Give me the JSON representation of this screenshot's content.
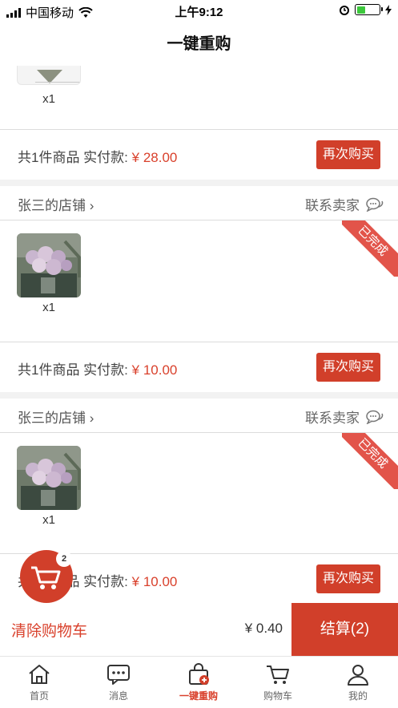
{
  "status_bar": {
    "carrier": "中国移动",
    "time": "上午9:12"
  },
  "nav": {
    "title": "一键重购"
  },
  "orders": [
    {
      "quantity": "x1",
      "summary_label": "共1件商品 实付款:",
      "price": "¥ 28.00",
      "rebuy_label": "再次购买"
    },
    {
      "shop_name": "张三的店铺",
      "contact_label": "联系卖家",
      "status_ribbon": "已完成",
      "quantity": "x1",
      "summary_label": "共1件商品 实付款:",
      "price": "¥ 10.00",
      "rebuy_label": "再次购买"
    },
    {
      "shop_name": "张三的店铺",
      "contact_label": "联系卖家",
      "status_ribbon": "已完成",
      "quantity": "x1",
      "summary_label": "共1件商品 实付款:",
      "price": "¥ 10.00",
      "rebuy_label": "再次购买"
    }
  ],
  "cart_fab": {
    "badge_count": "2"
  },
  "checkout": {
    "clear_label": "清除购物车",
    "total": "¥ 0.40",
    "settle_label": "结算(2)"
  },
  "tabbar": {
    "items": [
      {
        "label": "首页",
        "icon": "home-icon"
      },
      {
        "label": "消息",
        "icon": "message-icon"
      },
      {
        "label": "一键重购",
        "icon": "rebuy-bag-icon"
      },
      {
        "label": "购物车",
        "icon": "cart-icon"
      },
      {
        "label": "我的",
        "icon": "user-icon"
      }
    ]
  },
  "colors": {
    "accent": "#d13f2a",
    "price": "#d9412c",
    "ribbon": "#e2544a"
  }
}
